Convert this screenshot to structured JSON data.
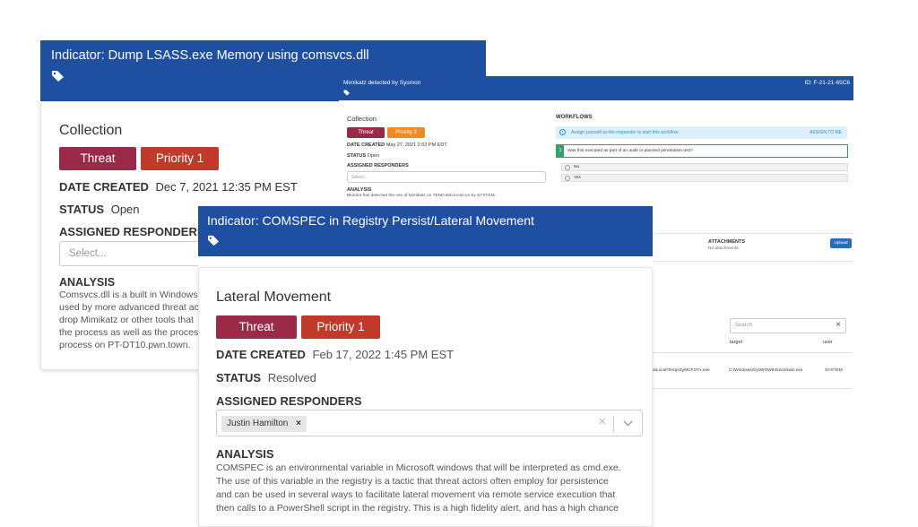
{
  "panel1": {
    "title": "Indicator: Dump LSASS.exe Memory using comsvcs.dll",
    "section": "Collection",
    "threat_label": "Threat",
    "priority_label": "Priority 1",
    "date_label": "DATE CREATED",
    "date_value": "Dec 7, 2021 12:35 PM EST",
    "status_label": "STATUS",
    "status_value": "Open",
    "responders_label": "ASSIGNED RESPONDERS",
    "select_placeholder": "Select...",
    "analysis_label": "ANALYSIS",
    "analysis_lines": [
      "Comsvcs.dll is a built in Windows",
      "used by more advanced threat ac",
      "drop Mimikatz or other tools that",
      "the process as well as the proces",
      "process on PT-DT10.pwn.town."
    ]
  },
  "panel2": {
    "title": "Mimikatz detected by Sysmon",
    "id_text": "ID: F-21-21-65C6",
    "section": "Collection",
    "threat_label": "Threat",
    "priority_label": "Priority 2",
    "date_label": "DATE CREATED",
    "date_value": "May 27, 2021 2:02 PM EDT",
    "status_label": "STATUS",
    "status_value": "Open",
    "responders_label": "ASSIGNED RESPONDERS",
    "select_placeholder": "Select...",
    "analysis_label": "ANALYSIS",
    "analysis_text": "Blumira has detected the use of Mimikatz on TEND.tleb.local run by SYSTEM.",
    "workflows_label": "WORKFLOWS",
    "assign_prompt": "Assign yourself as the responder to start this workflow",
    "assign_button": "ASSIGN TO ME",
    "question_num": "1",
    "question": "Was this executed as part of an audit or planned penetration test?",
    "option_no": "No",
    "option_yes": "Yes",
    "attachments_label": "ATTACHMENTS",
    "attachments_value": "No attachments.",
    "upload_button": "Upload",
    "search_placeholder": "Search",
    "col_target": "target",
    "col_user": "user",
    "row_path": "a\\Local\\Temp\\ZyMCFOTx.exe",
    "row_target": "C:\\Windows\\SysWOW64\\mimikatz.exe",
    "row_user": "SYSTEM"
  },
  "panel3": {
    "title": "Indicator: COMSPEC in Registry Persist/Lateral Movement",
    "section": "Lateral Movement",
    "threat_label": "Threat",
    "priority_label": "Priority 1",
    "date_label": "DATE CREATED",
    "date_value": "Feb 17, 2022 1:45 PM EST",
    "status_label": "STATUS",
    "status_value": "Resolved",
    "responders_label": "ASSIGNED RESPONDERS",
    "responder_chip": "Justin Hamilton",
    "analysis_label": "ANALYSIS",
    "analysis_lines": [
      "COMSPEC is an environmental variable in Microsoft windows that will be interpreted as cmd.exe.",
      "The use of this variable in the registry is a tactic that threat actors often employ for persistence",
      "and can be used in several ways to facilitate lateral movement via remote service execution that",
      "then calls to a PowerShell script in the registry. This is a high fidelity alert, and has a high chance"
    ]
  },
  "colors": {
    "header_blue": "#1f4fa0",
    "threat": "#9b2a49",
    "priority1": "#c0392b",
    "priority2": "#ef8a24"
  }
}
